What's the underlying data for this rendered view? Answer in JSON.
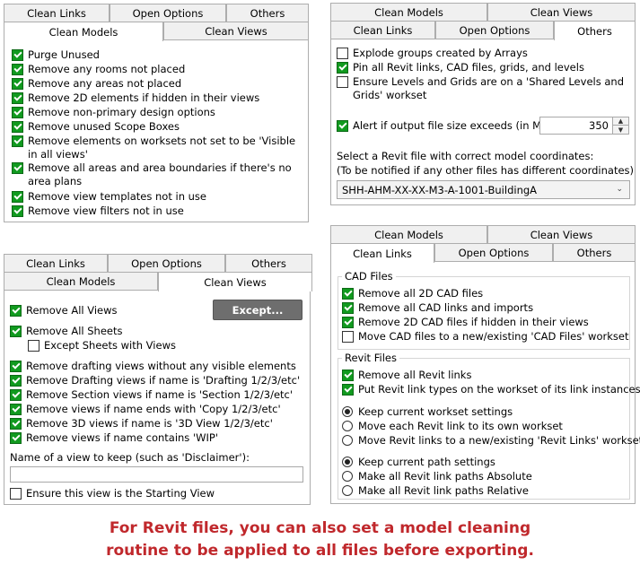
{
  "panel1": {
    "tabs_back": [
      "Clean Links",
      "Open Options",
      "Others"
    ],
    "tabs_front": [
      "Clean Models",
      "Clean Views"
    ],
    "items": [
      {
        "label": "Purge Unused",
        "checked": true
      },
      {
        "label": "Remove any rooms not placed",
        "checked": true
      },
      {
        "label": "Remove any areas not placed",
        "checked": true
      },
      {
        "label": "Remove 2D elements if hidden in their views",
        "checked": true
      },
      {
        "label": "Remove non-primary design options",
        "checked": true
      },
      {
        "label": "Remove unused Scope Boxes",
        "checked": true
      },
      {
        "label": "Remove elements on worksets not set to be 'Visible in all views'",
        "checked": true
      },
      {
        "label": "Remove all areas and area boundaries if there's no area plans",
        "checked": true
      },
      {
        "label": "Remove view templates not in use",
        "checked": true
      },
      {
        "label": "Remove view filters not in use",
        "checked": true
      }
    ]
  },
  "panel2": {
    "tabs_back": [
      "Clean Models",
      "Clean Views"
    ],
    "tabs_front": [
      "Clean Links",
      "Open Options",
      "Others"
    ],
    "items": [
      {
        "label": "Explode groups created by Arrays",
        "checked": false
      },
      {
        "label": "Pin all Revit links, CAD files, grids, and levels",
        "checked": true
      },
      {
        "label": "Ensure Levels and Grids are on a 'Shared Levels and Grids' workset",
        "checked": false
      }
    ],
    "alert_label": "Alert if output file size exceeds (in MB):",
    "alert_value": "350",
    "select_text_1": "Select a Revit file with correct model coordinates:",
    "select_text_2": "(To be notified if any other files has different coordinates)",
    "select_value": "SHH-AHM-XX-XX-M3-A-1001-BuildingA"
  },
  "panel3": {
    "tabs_back": [
      "Clean Links",
      "Open Options",
      "Others"
    ],
    "tabs_front": [
      "Clean Models",
      "Clean Views"
    ],
    "remove_all_views": "Remove All Views",
    "except_button": "Except...",
    "remove_all_sheets": "Remove All Sheets",
    "except_sheets": "Except Sheets with Views",
    "items": [
      {
        "label": "Remove drafting views without any visible elements",
        "checked": true
      },
      {
        "label": "Remove Drafting views if name is 'Drafting 1/2/3/etc'",
        "checked": true
      },
      {
        "label": "Remove Section views if name is 'Section 1/2/3/etc'",
        "checked": true
      },
      {
        "label": "Remove views if name ends with 'Copy 1/2/3/etc'",
        "checked": true
      },
      {
        "label": "Remove 3D views if name is '3D View 1/2/3/etc'",
        "checked": true
      },
      {
        "label": "Remove views if name contains 'WIP'",
        "checked": true
      }
    ],
    "keep_view_label": "Name of a view to keep (such as 'Disclaimer'):",
    "keep_view_value": "",
    "starting_view": "Ensure this view is the Starting View"
  },
  "panel4": {
    "tabs_back": [
      "Clean Models",
      "Clean Views"
    ],
    "tabs_front": [
      "Clean Links",
      "Open Options",
      "Others"
    ],
    "cad_title": "CAD Files",
    "cad_items": [
      {
        "label": "Remove all 2D CAD files",
        "checked": true
      },
      {
        "label": "Remove all CAD links and imports",
        "checked": true
      },
      {
        "label": "Remove 2D CAD files if hidden in their views",
        "checked": true
      },
      {
        "label": "Move CAD files to a new/existing 'CAD Files' workset",
        "checked": false
      }
    ],
    "revit_title": "Revit Files",
    "revit_items": [
      {
        "label": "Remove all Revit links",
        "checked": true
      },
      {
        "label": "Put Revit link types on the workset of its link instances",
        "checked": true
      }
    ],
    "workset_radios": [
      {
        "label": "Keep current workset settings",
        "selected": true
      },
      {
        "label": "Move each Revit link to its own workset",
        "selected": false
      },
      {
        "label": "Move Revit links to a new/existing 'Revit Links' workset",
        "selected": false
      }
    ],
    "path_radios": [
      {
        "label": "Keep current path settings",
        "selected": true
      },
      {
        "label": "Make all Revit link paths Absolute",
        "selected": false
      },
      {
        "label": "Make all Revit link paths Relative",
        "selected": false
      }
    ]
  },
  "footer": {
    "line1": "For Revit files, you can also set a model cleaning",
    "line2": "routine to be applied to all files before exporting."
  },
  "colors": {
    "check_green": "#119a1f",
    "footer_red": "#c0282c",
    "button_grey": "#6e6e6e"
  }
}
